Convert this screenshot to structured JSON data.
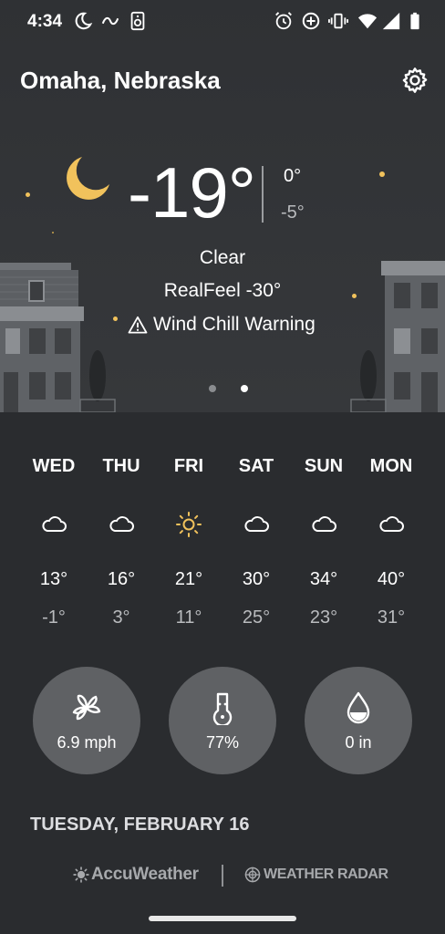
{
  "status_bar": {
    "time": "4:34",
    "icons": [
      "night-mode-icon",
      "link-icon",
      "speaker-icon",
      "alarm-icon",
      "data-saver-icon",
      "vibrate-icon",
      "wifi-icon",
      "signal-icon",
      "battery-icon"
    ]
  },
  "header": {
    "location": "Omaha, Nebraska",
    "settings_icon": "gear-icon"
  },
  "current": {
    "temperature": "-19°",
    "high": "0°",
    "low": "-5°",
    "condition": "Clear",
    "realfeel": "RealFeel -30°",
    "alert": "Wind Chill Warning",
    "condition_icon": "moon-icon",
    "page_count": 2,
    "active_page": 2
  },
  "forecast": [
    {
      "day": "WED",
      "icon": "cloud-icon",
      "high": "13°",
      "low": "-1°"
    },
    {
      "day": "THU",
      "icon": "cloud-icon",
      "high": "16°",
      "low": "3°"
    },
    {
      "day": "FRI",
      "icon": "sun-icon",
      "high": "21°",
      "low": "11°"
    },
    {
      "day": "SAT",
      "icon": "cloud-icon",
      "high": "30°",
      "low": "25°"
    },
    {
      "day": "SUN",
      "icon": "cloud-icon",
      "high": "34°",
      "low": "23°"
    },
    {
      "day": "MON",
      "icon": "cloud-icon",
      "high": "40°",
      "low": "31°"
    }
  ],
  "details": {
    "wind": {
      "icon": "wind-icon",
      "value": "6.9 mph"
    },
    "humidity": {
      "icon": "humidity-icon",
      "value": "77%"
    },
    "precipitation": {
      "icon": "precipitation-icon",
      "value": "0 in"
    }
  },
  "date": "TUESDAY, FEBRUARY 16",
  "footer": {
    "brand1": "AccuWeather",
    "brand2": "WEATHER RADAR"
  },
  "colors": {
    "background": "#2a2c2f",
    "sky": "#343639",
    "circle": "#5f6164",
    "accent_yellow": "#f1c25c"
  }
}
